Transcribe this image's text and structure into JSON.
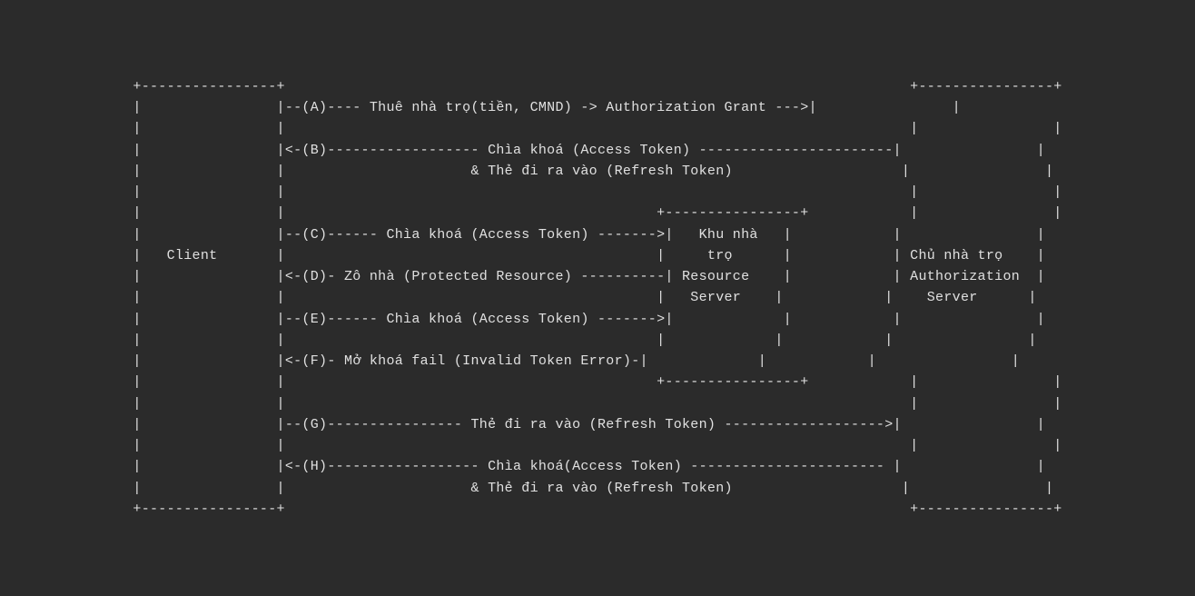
{
  "diagram": {
    "content": "+----------------+                                                      +----------------+\n|                |---(A)---- Thuê nhà trọ(tiền, CMND) -> Authorization Grant --->|                |\n|                |                                                               |                |\n|                |<-(B)------------------ Chìa khoá (Access Token) -------------|                |\n|                |                      & Thẻ đi ra vào (Refresh Token)         |                |\n|                |                                                               |                |\n|                |                                      +----------------+       |                |\n|                |---(C)------ Chìa khoá (Access Token) -------->| Khu nhà |      |                |\n|   Client       |                                               |   trọ   |      | Chủ nhà trọ   |\n|                |<-(D)- Zô nhà (Protected Resource) ----------| Resource |      | Authorization  |\n|                |                                               |  Server |      |    Server      |\n|                |---(E)------ Chìa khoá (Access Token) -------->|         |      |                |\n|                |                                               |         |      |                |\n|                |<-(F)- Mở khoá fail (Invalid Token Error)-|         |      |                |\n|                |                                              +----------------+       |                |\n|                |                                                               |                |\n|                |---(G)---------------- Thẻ đi ra vào (Refresh Token) -------->|                |\n|                |                                                               |                |\n|                |<-(H)------------------ Chìa khoá(Access Token) --------------|                |\n|                |                      & Thẻ đi ra vào (Refresh Token)         |                |\n+----------------+                                                      +----------------+"
  }
}
